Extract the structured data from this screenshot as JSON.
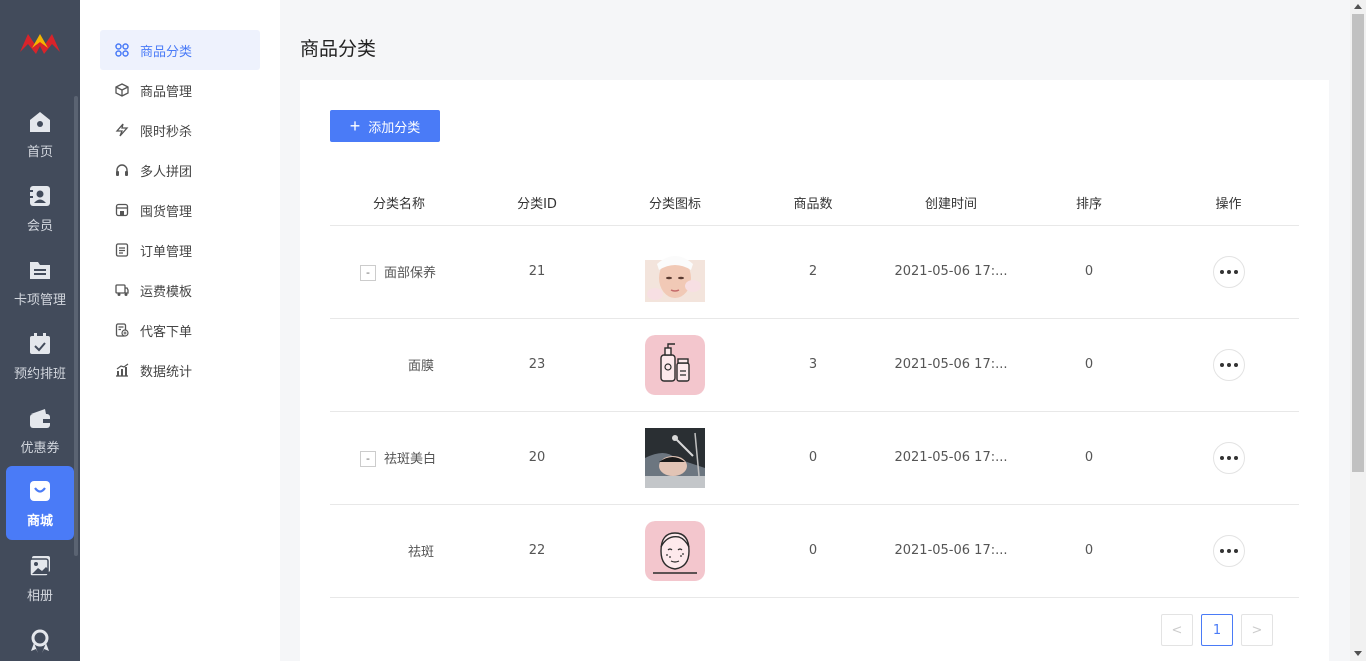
{
  "rail": {
    "items": [
      {
        "label": "首页",
        "icon": "home-icon"
      },
      {
        "label": "会员",
        "icon": "member-icon"
      },
      {
        "label": "卡项管理",
        "icon": "folder-icon"
      },
      {
        "label": "预约排班",
        "icon": "calendar-icon"
      },
      {
        "label": "优惠券",
        "icon": "wallet-icon"
      },
      {
        "label": "商城",
        "icon": "shopping-bag-icon"
      },
      {
        "label": "相册",
        "icon": "album-icon"
      }
    ],
    "active_index": 5
  },
  "submenu": {
    "items": [
      {
        "label": "商品分类",
        "icon": "grid-icon"
      },
      {
        "label": "商品管理",
        "icon": "cube-icon"
      },
      {
        "label": "限时秒杀",
        "icon": "lightning-icon"
      },
      {
        "label": "多人拼团",
        "icon": "headset-icon"
      },
      {
        "label": "囤货管理",
        "icon": "store-icon"
      },
      {
        "label": "订单管理",
        "icon": "document-icon"
      },
      {
        "label": "运费模板",
        "icon": "truck-icon"
      },
      {
        "label": "代客下单",
        "icon": "order-add-icon"
      },
      {
        "label": "数据统计",
        "icon": "chart-icon"
      }
    ],
    "active_index": 0
  },
  "page": {
    "title": "商品分类",
    "add_button": "添加分类"
  },
  "table": {
    "headers": [
      "分类名称",
      "分类ID",
      "分类图标",
      "商品数",
      "创建时间",
      "排序",
      "操作"
    ],
    "rows": [
      {
        "name": "面部保养",
        "expander": "-",
        "id": "21",
        "icon": "face-care-photo",
        "count": "2",
        "created": "2021-05-06 17:...",
        "sort": "0"
      },
      {
        "name": "面膜",
        "expander": "",
        "id": "23",
        "icon": "mask-bottles-icon",
        "count": "3",
        "created": "2021-05-06 17:...",
        "sort": "0"
      },
      {
        "name": "祛斑美白",
        "expander": "-",
        "id": "20",
        "icon": "whitening-photo",
        "count": "0",
        "created": "2021-05-06 17:...",
        "sort": "0"
      },
      {
        "name": "祛斑",
        "expander": "",
        "id": "22",
        "icon": "freckle-face-icon",
        "count": "0",
        "created": "2021-05-06 17:...",
        "sort": "0"
      }
    ]
  },
  "pagination": {
    "prev": "<",
    "current": "1",
    "next": ">"
  },
  "colors": {
    "rail_bg": "#424b5b",
    "accent": "#4a7bf7",
    "page_bg": "#f5f6f8"
  }
}
